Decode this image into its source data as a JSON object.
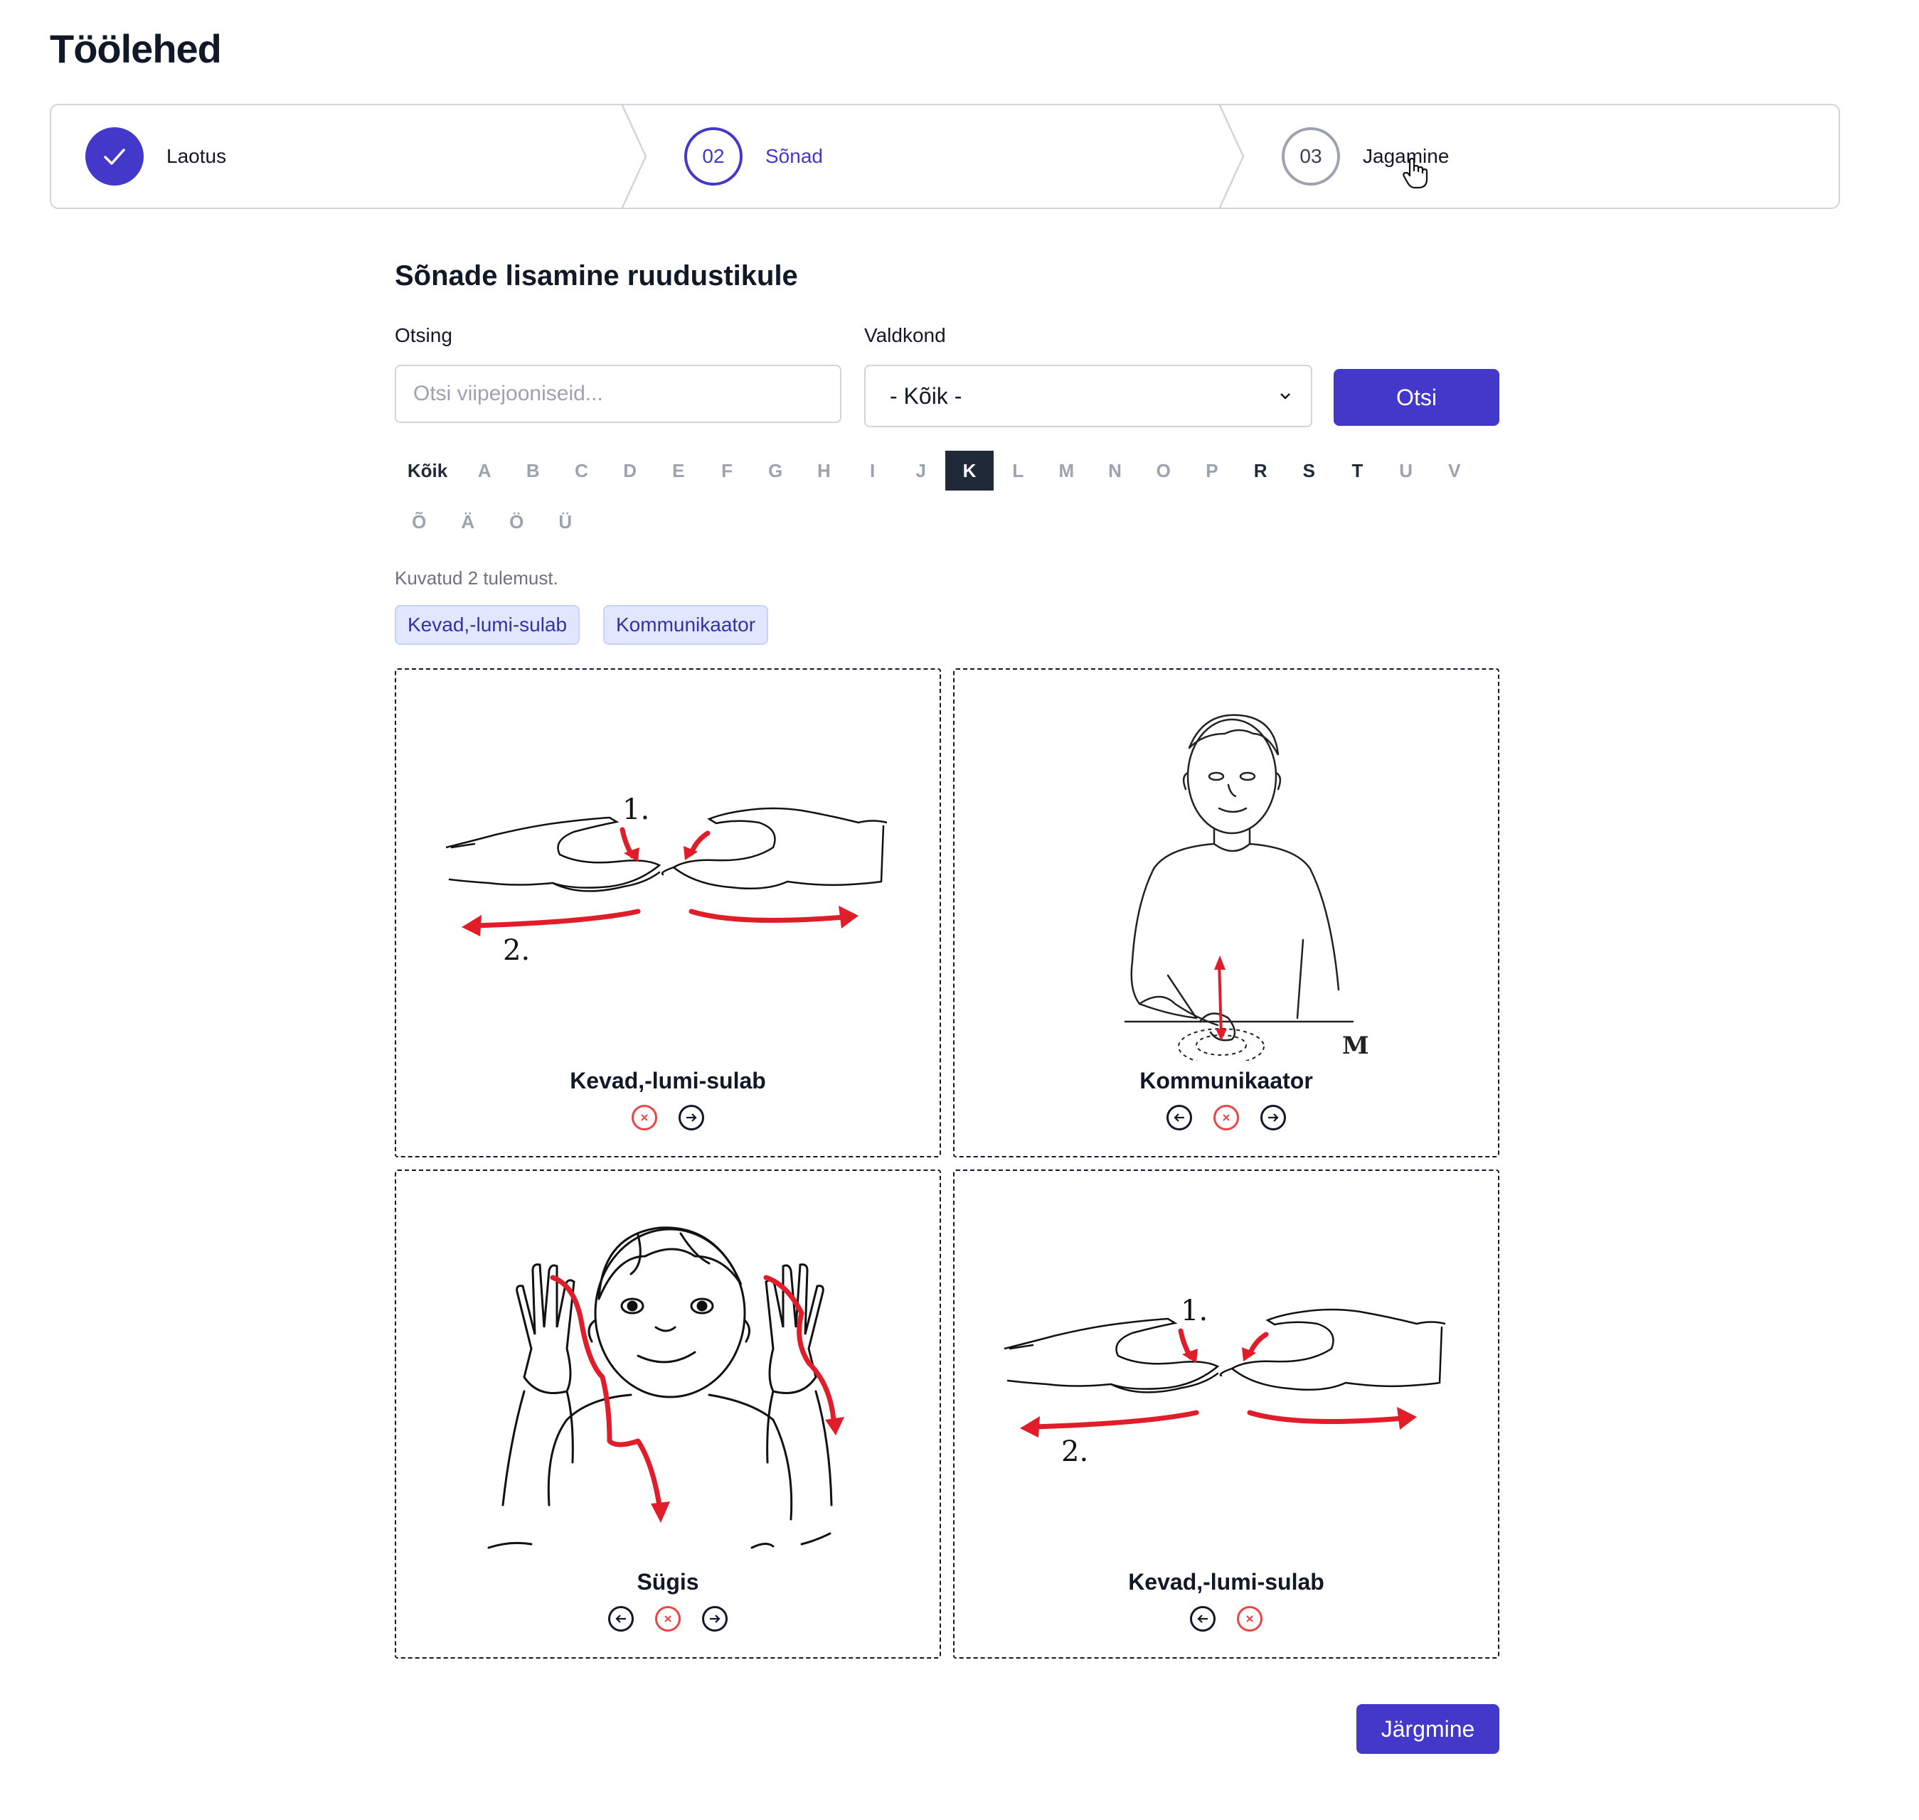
{
  "page": {
    "title": "Töölehed"
  },
  "stepper": {
    "steps": [
      {
        "number": "",
        "label": "Laotus",
        "state": "done"
      },
      {
        "number": "02",
        "label": "Sõnad",
        "state": "current"
      },
      {
        "number": "03",
        "label": "Jagamine",
        "state": "todo"
      }
    ]
  },
  "main": {
    "section_title": "Sõnade lisamine ruudustikule",
    "search": {
      "label": "Otsing",
      "placeholder": "Otsi viipejooniseid...",
      "value": ""
    },
    "category": {
      "label": "Valdkond",
      "selected": "- Kõik -"
    },
    "search_button": "Otsi",
    "letters_row1": [
      "Kõik",
      "A",
      "B",
      "C",
      "D",
      "E",
      "F",
      "G",
      "H",
      "I",
      "J",
      "K",
      "L",
      "M",
      "N",
      "O",
      "P",
      "R",
      "S",
      "T",
      "U",
      "V"
    ],
    "letters_row2": [
      "Õ",
      "Ä",
      "Ö",
      "Ü"
    ],
    "active_letter": "K",
    "dark_letters": [
      "Kõik",
      "R",
      "S",
      "T"
    ],
    "result_count": "Kuvatud 2 tulemust.",
    "results": [
      "Kevad,-lumi-sulab",
      "Kommunikaator"
    ]
  },
  "grid": {
    "cards": [
      {
        "label": "Kevad,-lumi-sulab",
        "image": "spring-snow-melts-sign",
        "actions": [
          "remove",
          "move-right"
        ]
      },
      {
        "label": "Kommunikaator",
        "image": "communicator-sign",
        "actions": [
          "move-left",
          "remove",
          "move-right"
        ]
      },
      {
        "label": "Sügis",
        "image": "autumn-sign",
        "actions": [
          "move-left",
          "remove",
          "move-right"
        ]
      },
      {
        "label": "Kevad,-lumi-sulab",
        "image": "spring-snow-melts-sign",
        "actions": [
          "move-left",
          "remove"
        ]
      }
    ]
  },
  "footer": {
    "next_button": "Järgmine"
  },
  "colors": {
    "accent": "#4338ca",
    "danger": "#ef4444",
    "chip_bg": "#e0e7ff",
    "text": "#111827",
    "muted": "#9ca3af"
  }
}
